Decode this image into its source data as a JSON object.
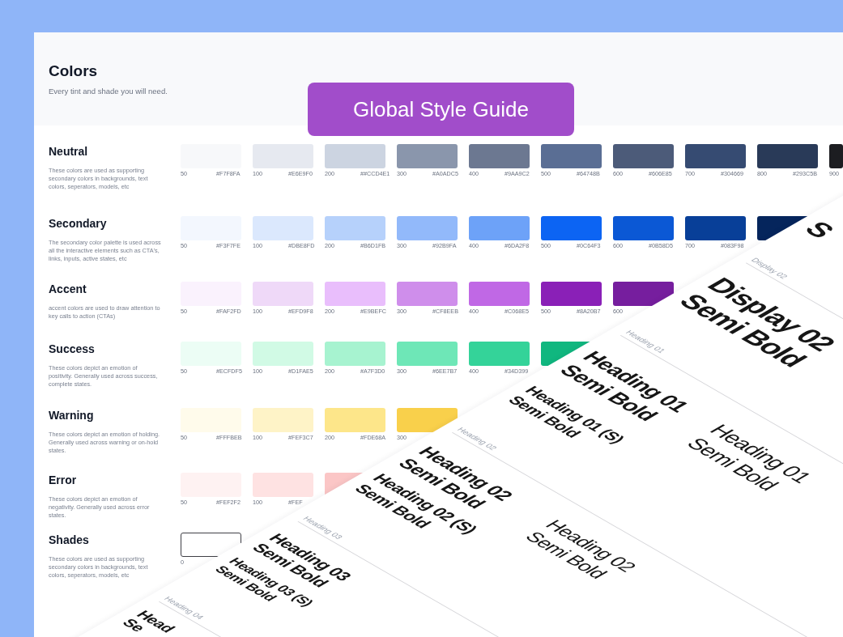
{
  "header": {
    "title": "Colors",
    "subtitle": "Every tint and shade you will need."
  },
  "banner": {
    "title": "Global Style Guide"
  },
  "palettes": [
    {
      "name": "Neutral",
      "kind": "filled",
      "description_lines": [
        "These colors are used as supporting",
        "secondary colors in backgrounds, text",
        "colors, seperators, models, etc"
      ],
      "swatches": [
        {
          "shade": "50",
          "hex": "#F7F8FA",
          "color": "#f7f8fa"
        },
        {
          "shade": "100",
          "hex": "#E6E9F0",
          "color": "#e6e9f0"
        },
        {
          "shade": "200",
          "hex": "##CCD4E1",
          "color": "#ccd4e1"
        },
        {
          "shade": "300",
          "hex": "#A0ADC5",
          "color": "#8a96ac"
        },
        {
          "shade": "400",
          "hex": "#9AA9C2",
          "color": "#6c7891"
        },
        {
          "shade": "500",
          "hex": "#64748B",
          "color": "#5a6e94"
        },
        {
          "shade": "600",
          "hex": "#606E85",
          "color": "#4c5b79"
        },
        {
          "shade": "700",
          "hex": "#304669",
          "color": "#364b72"
        },
        {
          "shade": "800",
          "hex": "#293C5B",
          "color": "#293a58"
        },
        {
          "shade": "900",
          "color": "#1c1d21"
        }
      ]
    },
    {
      "name": "Secondary",
      "kind": "filled",
      "description_lines": [
        "The secondary color palette is used across",
        "all the interactive elements such as CTA's,",
        "links, inputs, active states, etc"
      ],
      "swatches": [
        {
          "shade": "50",
          "hex": "#F3F7FE",
          "color": "#f3f7fe"
        },
        {
          "shade": "100",
          "hex": "#DBE8FD",
          "color": "#dbe8fd"
        },
        {
          "shade": "200",
          "hex": "#B6D1FB",
          "color": "#b6d1fb"
        },
        {
          "shade": "300",
          "hex": "#92B9FA",
          "color": "#92b9fa"
        },
        {
          "shade": "400",
          "hex": "#6DA2F8",
          "color": "#6da2f8"
        },
        {
          "shade": "500",
          "hex": "#0C64F3",
          "color": "#0c64f3"
        },
        {
          "shade": "600",
          "hex": "#0B58D5",
          "color": "#0b58d5"
        },
        {
          "shade": "700",
          "hex": "#083F98",
          "color": "#083f98"
        },
        {
          "color": "#05255c"
        }
      ]
    },
    {
      "name": "Accent",
      "kind": "filled",
      "description_lines": [
        "accent colors are used to draw attention to",
        "key calls to action (CTAs)"
      ],
      "swatches": [
        {
          "shade": "50",
          "hex": "#FAF2FD",
          "color": "#faf2fd"
        },
        {
          "shade": "100",
          "hex": "#EFD9F8",
          "color": "#efd9f8"
        },
        {
          "shade": "200",
          "hex": "#E9BEFC",
          "color": "#e9befc"
        },
        {
          "shade": "300",
          "hex": "#CF8EEB",
          "color": "#cf8eeb"
        },
        {
          "shade": "400",
          "hex": "#C068E5",
          "color": "#c068e5"
        },
        {
          "shade": "500",
          "hex": "#8A20B7",
          "color": "#8a20b7"
        },
        {
          "shade": "600",
          "color": "#761e9e"
        }
      ]
    },
    {
      "name": "Success",
      "kind": "filled",
      "description_lines": [
        "These colors depict an emotion of",
        "positivity. Generally used across success,",
        "complete states."
      ],
      "swatches": [
        {
          "shade": "50",
          "hex": "#ECFDF5",
          "color": "#ecfdf5"
        },
        {
          "shade": "100",
          "hex": "#D1FAE5",
          "color": "#d1fae5"
        },
        {
          "shade": "200",
          "hex": "#A7F3D0",
          "color": "#a7f3d0"
        },
        {
          "shade": "300",
          "hex": "#6EE7B7",
          "color": "#6ee7b7"
        },
        {
          "shade": "400",
          "hex": "#34D399",
          "color": "#34d399"
        },
        {
          "color": "#10b77f"
        }
      ]
    },
    {
      "name": "Warning",
      "kind": "filled",
      "description_lines": [
        "These colors depict an emotion of holding.",
        "Generally used across warning or on-hold",
        "states."
      ],
      "swatches": [
        {
          "shade": "50",
          "hex": "#FFFBEB",
          "color": "#fffbeb"
        },
        {
          "shade": "100",
          "hex": "#FEF3C7",
          "color": "#fef3c7"
        },
        {
          "shade": "200",
          "hex": "#FDE68A",
          "color": "#fde68a"
        },
        {
          "shade": "300",
          "color": "#f9d04b"
        }
      ]
    },
    {
      "name": "Error",
      "kind": "filled",
      "description_lines": [
        "These colors depict an emotion of",
        "negativity. Generally used across error",
        "states."
      ],
      "swatches": [
        {
          "shade": "50",
          "hex": "#FEF2F2",
          "color": "#fef2f2"
        },
        {
          "shade": "100",
          "hex": "#FEF",
          "color": "#fee2e2"
        },
        {
          "color": "#fbc6c6"
        }
      ]
    },
    {
      "name": "Shades",
      "kind": "outlined",
      "description_lines": [
        "These colors are used as supporting",
        "secondary colors in backgrounds, text",
        "colors, seperators, models, etc"
      ],
      "swatches": [
        {
          "shade": "0",
          "color": "#ffffff"
        }
      ]
    }
  ],
  "type_sheet": {
    "sections": [
      {
        "rows": [
          {
            "specimens": [
              {
                "kind": "display",
                "lines": [
                  "S"
                ]
              }
            ]
          }
        ]
      },
      {
        "label": "Display 02",
        "rows": [
          {
            "specimens": [
              {
                "kind": "display",
                "lines": [
                  "Display 02",
                  "Semi Bold"
                ]
              }
            ]
          }
        ]
      },
      {
        "label": "Heading 01",
        "rows": [
          {
            "specimens": [
              {
                "kind": "h1",
                "lines": [
                  "Heading 01",
                  "Semi Bold"
                ]
              },
              {
                "kind": "h1",
                "lines": [
                  "Heading 01",
                  "Semi Bold"
                ]
              }
            ]
          },
          {
            "specimens": [
              {
                "kind": "h1-small",
                "lines": [
                  "Heading 01 (S)",
                  "Semi Bold"
                ]
              }
            ]
          }
        ]
      },
      {
        "label": "Heading 02",
        "rows": [
          {
            "specimens": [
              {
                "kind": "h2",
                "lines": [
                  "Heading 02",
                  "Semi Bold"
                ]
              },
              {
                "kind": "h2",
                "lines": [
                  "Heading 02",
                  "Semi Bold"
                ]
              }
            ]
          },
          {
            "specimens": [
              {
                "kind": "h2-small",
                "lines": [
                  "Heading 02 (S)",
                  "Semi Bold"
                ]
              }
            ]
          }
        ]
      },
      {
        "label": "Heading 03",
        "rows": [
          {
            "specimens": [
              {
                "kind": "h3",
                "lines": [
                  "Heading 03",
                  "Semi Bold"
                ]
              }
            ]
          },
          {
            "specimens": [
              {
                "kind": "h3-small",
                "lines": [
                  "Heading 03 (S)",
                  "Semi Bold"
                ]
              }
            ]
          }
        ]
      },
      {
        "label": "Heading 04",
        "rows": [
          {
            "specimens": [
              {
                "kind": "h4",
                "lines": [
                  "Head",
                  "Se"
                ]
              }
            ]
          }
        ]
      }
    ]
  }
}
